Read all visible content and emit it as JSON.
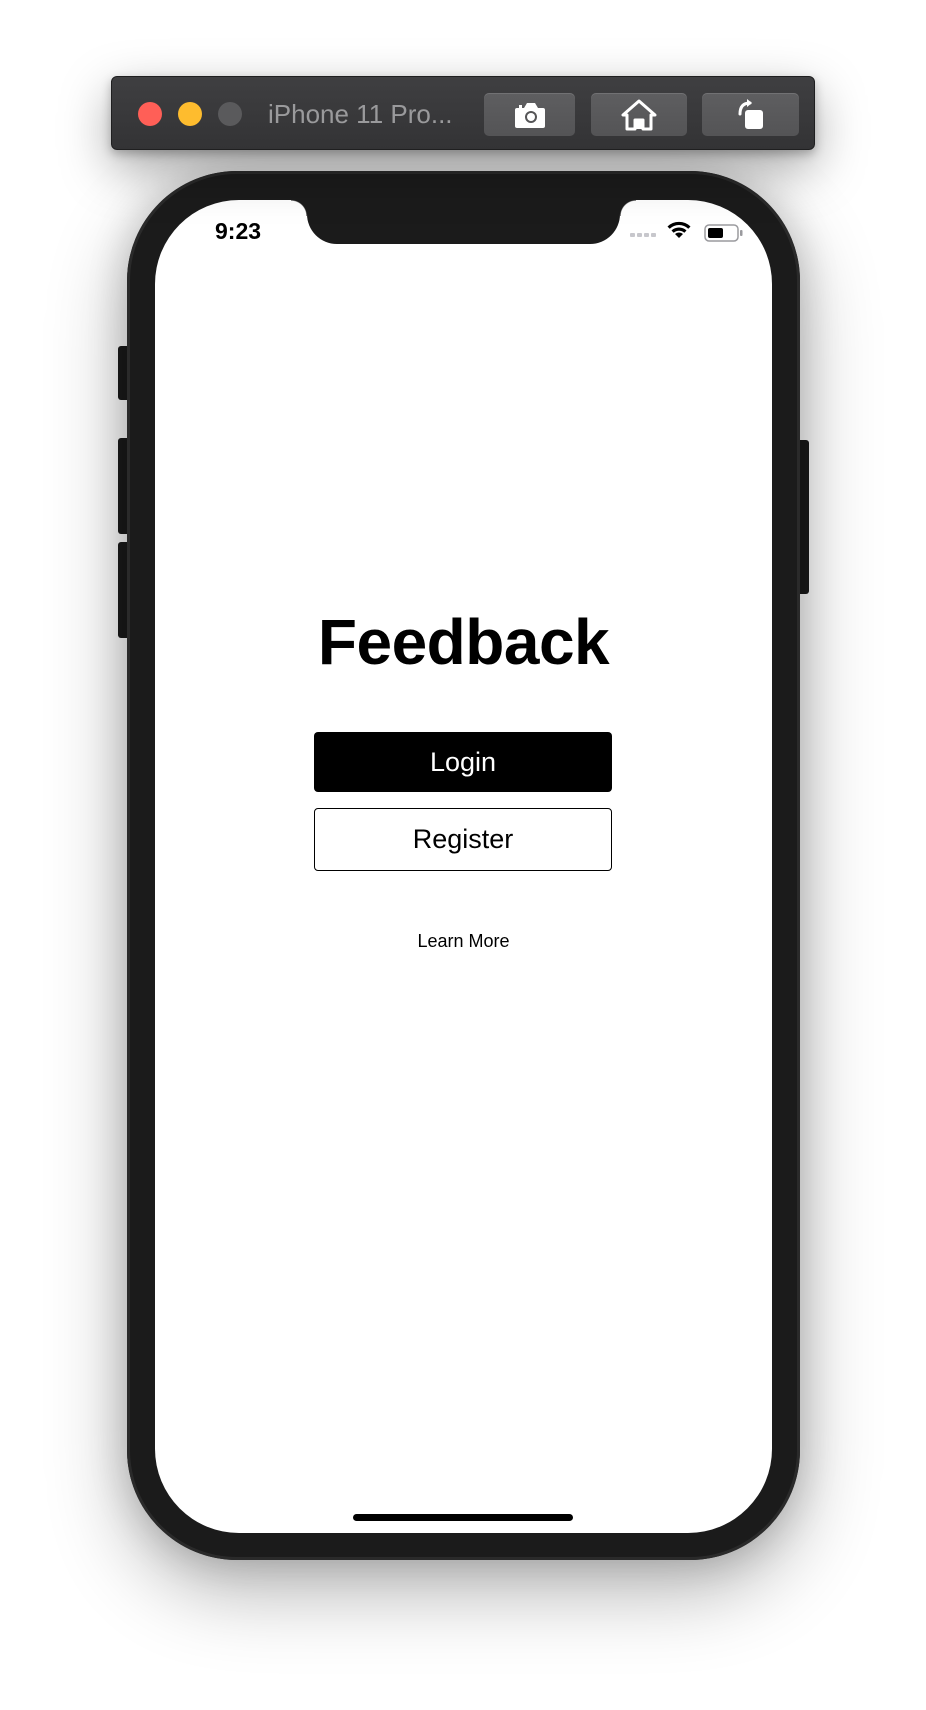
{
  "simulator": {
    "title": "iPhone 11 Pro...",
    "traffic_colors": {
      "close": "#ff5f57",
      "minimize": "#febc2e",
      "zoom": "#5a5a5c"
    },
    "toolbar_icons": {
      "screenshot": "camera-icon",
      "home": "home-icon",
      "rotate": "rotate-icon"
    }
  },
  "status_bar": {
    "time": "9:23",
    "icons": [
      "cell-signal-icon",
      "wifi-icon",
      "battery-icon"
    ]
  },
  "app": {
    "title": "Feedback",
    "login_label": "Login",
    "register_label": "Register",
    "learn_more_label": "Learn More"
  },
  "colors": {
    "device_frame": "#1b1b1b",
    "screen_bg": "#ffffff",
    "primary_button_bg": "#000000",
    "primary_button_text": "#ffffff"
  }
}
